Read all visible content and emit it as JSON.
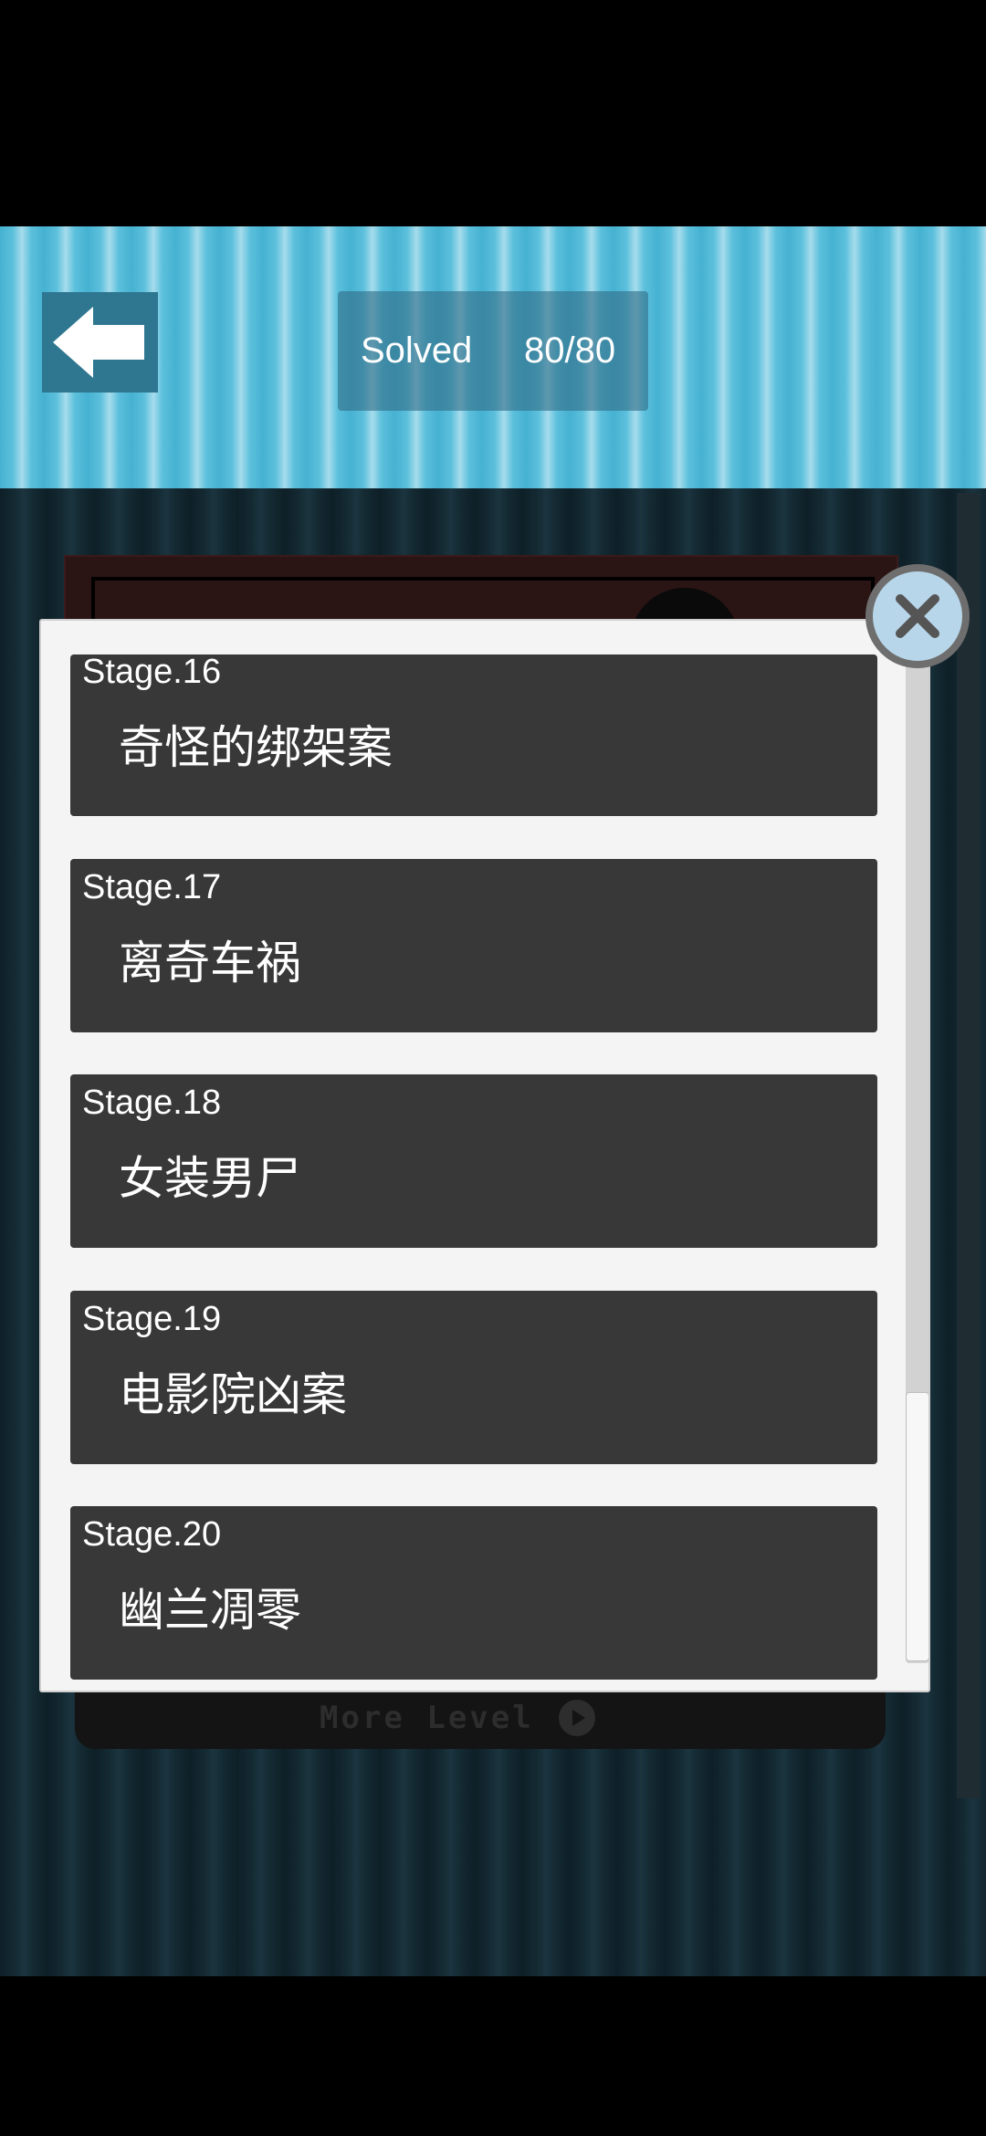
{
  "header": {
    "back_icon": "arrow-left-icon",
    "solved_label": "Solved",
    "solved_count": "80/80"
  },
  "background": {
    "more_level_label": "More Level",
    "more_level_icon": "play-icon"
  },
  "modal": {
    "close_icon": "close-icon",
    "stages": [
      {
        "number": "Stage.16",
        "title": "奇怪的绑架案"
      },
      {
        "number": "Stage.17",
        "title": "离奇车祸"
      },
      {
        "number": "Stage.18",
        "title": "女装男尸"
      },
      {
        "number": "Stage.19",
        "title": "电影院凶案"
      },
      {
        "number": "Stage.20",
        "title": "幽兰凋零"
      }
    ]
  },
  "colors": {
    "header_accent": "#46b1d2",
    "stage_card": "#383838",
    "modal_bg": "#f4f4f4"
  }
}
